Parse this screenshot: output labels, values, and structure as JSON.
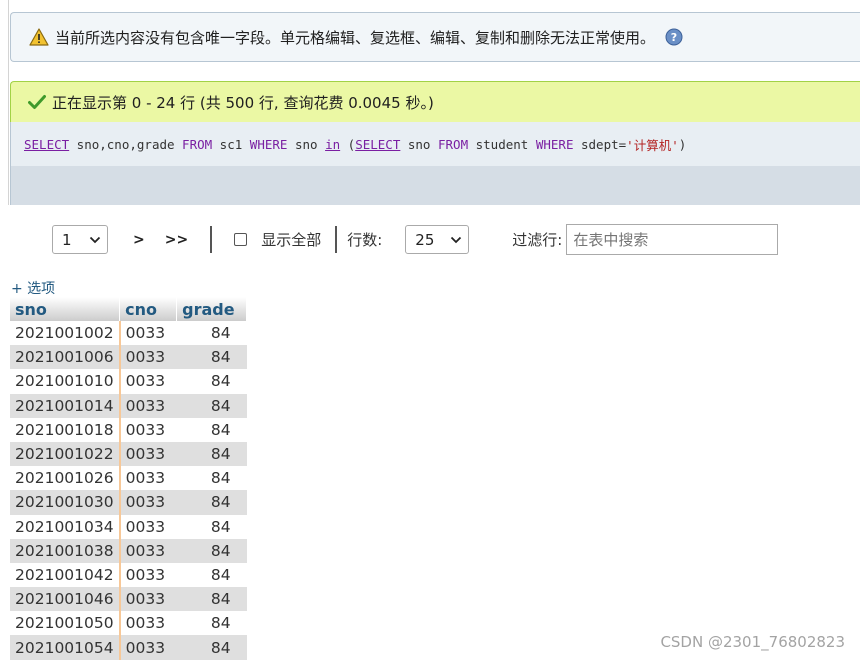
{
  "notice": {
    "text": "当前所选内容没有包含唯一字段。单元格编辑、复选框、编辑、复制和删除无法正常使用。",
    "icon": "warning-icon",
    "help_icon": "help-icon"
  },
  "success": {
    "text": "正在显示第 0 - 24 行 (共 500 行, 查询花费 0.0045 秒。)",
    "icon": "check-icon"
  },
  "sql": {
    "parts": [
      {
        "t": "SELECT",
        "c": "kw-link"
      },
      {
        "t": " sno,cno,grade ",
        "c": ""
      },
      {
        "t": "FROM",
        "c": "kw"
      },
      {
        "t": " sc1 ",
        "c": ""
      },
      {
        "t": "WHERE",
        "c": "kw"
      },
      {
        "t": " sno ",
        "c": ""
      },
      {
        "t": "in",
        "c": "kw-link"
      },
      {
        "t": " (",
        "c": ""
      },
      {
        "t": "SELECT",
        "c": "kw-link"
      },
      {
        "t": " sno ",
        "c": ""
      },
      {
        "t": "FROM",
        "c": "kw"
      },
      {
        "t": " student ",
        "c": ""
      },
      {
        "t": "WHERE",
        "c": "kw"
      },
      {
        "t": " sdept=",
        "c": ""
      },
      {
        "t": "'计算机'",
        "c": "str"
      },
      {
        "t": ")",
        "c": ""
      }
    ]
  },
  "nav": {
    "page_value": "1",
    "next_label": ">",
    "last_label": ">>",
    "show_all_label": "显示全部",
    "rows_label": "行数:",
    "rows_value": "25",
    "filter_label": "过滤行:",
    "filter_placeholder": "在表中搜索"
  },
  "options_label": "+ 选项",
  "table": {
    "columns": [
      "sno",
      "cno",
      "grade"
    ],
    "rows": [
      [
        "2021001002",
        "0033",
        "84"
      ],
      [
        "2021001006",
        "0033",
        "84"
      ],
      [
        "2021001010",
        "0033",
        "84"
      ],
      [
        "2021001014",
        "0033",
        "84"
      ],
      [
        "2021001018",
        "0033",
        "84"
      ],
      [
        "2021001022",
        "0033",
        "84"
      ],
      [
        "2021001026",
        "0033",
        "84"
      ],
      [
        "2021001030",
        "0033",
        "84"
      ],
      [
        "2021001034",
        "0033",
        "84"
      ],
      [
        "2021001038",
        "0033",
        "84"
      ],
      [
        "2021001042",
        "0033",
        "84"
      ],
      [
        "2021001046",
        "0033",
        "84"
      ],
      [
        "2021001050",
        "0033",
        "84"
      ],
      [
        "2021001054",
        "0033",
        "84"
      ]
    ]
  },
  "watermark": "CSDN @2301_76802823",
  "colors": {
    "notice_bg": "#f2f6f9",
    "success_bg": "#ebf8a4",
    "success_border": "#a2d246",
    "keyword": "#7a1fa2",
    "string": "#b32222",
    "header_text": "#235a81",
    "row_alt": "#dfdfdf",
    "column_marker": "#f7c898"
  }
}
